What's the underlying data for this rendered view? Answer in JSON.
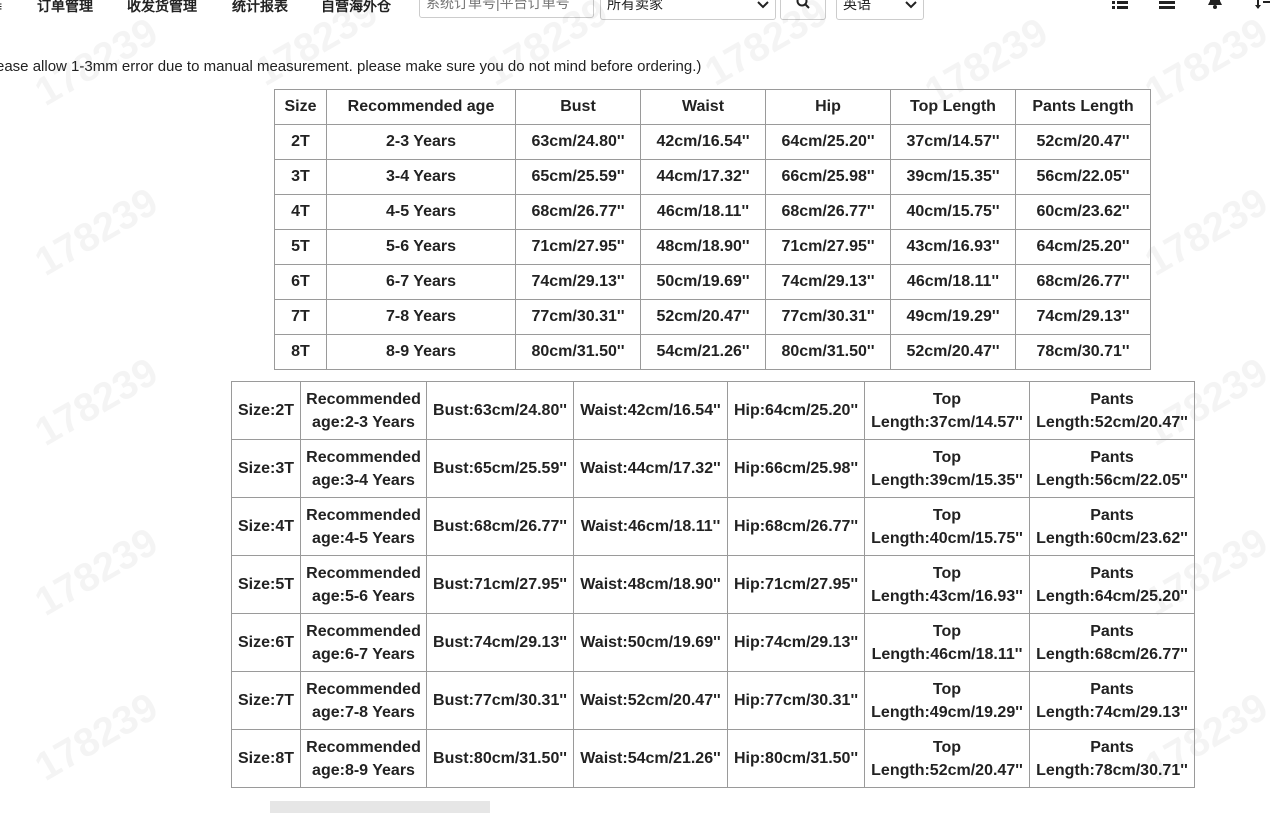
{
  "topbar": {
    "nav": [
      "订单管理",
      "收发货管理",
      "统计报表",
      "自营海外仓"
    ],
    "search_placeholder": "系统订单号|平台订单号",
    "buyer_select": "所有卖家",
    "language_select": "英语",
    "icons": [
      "list-icon",
      "menu-icon",
      "bell-icon",
      "sort-icon",
      "search-icon"
    ]
  },
  "note": "ease allow 1-3mm error due to manual measurement. please make sure you do not mind before ordering.)",
  "watermark": "178239",
  "table1": {
    "headers": [
      "Size",
      "Recommended age",
      "Bust",
      "Waist",
      "Hip",
      "Top Length",
      "Pants Length"
    ],
    "rows": [
      [
        "2T",
        "2-3 Years",
        "63cm/24.80''",
        "42cm/16.54''",
        "64cm/25.20''",
        "37cm/14.57''",
        "52cm/20.47''"
      ],
      [
        "3T",
        "3-4 Years",
        "65cm/25.59''",
        "44cm/17.32''",
        "66cm/25.98''",
        "39cm/15.35''",
        "56cm/22.05''"
      ],
      [
        "4T",
        "4-5 Years",
        "68cm/26.77''",
        "46cm/18.11''",
        "68cm/26.77''",
        "40cm/15.75''",
        "60cm/23.62''"
      ],
      [
        "5T",
        "5-6 Years",
        "71cm/27.95''",
        "48cm/18.90''",
        "71cm/27.95''",
        "43cm/16.93''",
        "64cm/25.20''"
      ],
      [
        "6T",
        "6-7 Years",
        "74cm/29.13''",
        "50cm/19.69''",
        "74cm/29.13''",
        "46cm/18.11''",
        "68cm/26.77''"
      ],
      [
        "7T",
        "7-8 Years",
        "77cm/30.31''",
        "52cm/20.47''",
        "77cm/30.31''",
        "49cm/19.29''",
        "74cm/29.13''"
      ],
      [
        "8T",
        "8-9 Years",
        "80cm/31.50''",
        "54cm/21.26''",
        "80cm/31.50''",
        "52cm/20.47''",
        "78cm/30.71''"
      ]
    ]
  },
  "table2": {
    "rows": [
      [
        [
          "Size:2T"
        ],
        [
          "Recommended",
          "age:2-3 Years"
        ],
        [
          "Bust:63cm/24.80''"
        ],
        [
          "Waist:42cm/16.54''"
        ],
        [
          "Hip:64cm/25.20''"
        ],
        [
          "Top",
          "Length:37cm/14.57''"
        ],
        [
          "Pants",
          "Length:52cm/20.47''"
        ]
      ],
      [
        [
          "Size:3T"
        ],
        [
          "Recommended",
          "age:3-4 Years"
        ],
        [
          "Bust:65cm/25.59''"
        ],
        [
          "Waist:44cm/17.32''"
        ],
        [
          "Hip:66cm/25.98''"
        ],
        [
          "Top",
          "Length:39cm/15.35''"
        ],
        [
          "Pants",
          "Length:56cm/22.05''"
        ]
      ],
      [
        [
          "Size:4T"
        ],
        [
          "Recommended",
          "age:4-5 Years"
        ],
        [
          "Bust:68cm/26.77''"
        ],
        [
          "Waist:46cm/18.11''"
        ],
        [
          "Hip:68cm/26.77''"
        ],
        [
          "Top",
          "Length:40cm/15.75''"
        ],
        [
          "Pants",
          "Length:60cm/23.62''"
        ]
      ],
      [
        [
          "Size:5T"
        ],
        [
          "Recommended",
          "age:5-6 Years"
        ],
        [
          "Bust:71cm/27.95''"
        ],
        [
          "Waist:48cm/18.90''"
        ],
        [
          "Hip:71cm/27.95''"
        ],
        [
          "Top",
          "Length:43cm/16.93''"
        ],
        [
          "Pants",
          "Length:64cm/25.20''"
        ]
      ],
      [
        [
          "Size:6T"
        ],
        [
          "Recommended",
          "age:6-7 Years"
        ],
        [
          "Bust:74cm/29.13''"
        ],
        [
          "Waist:50cm/19.69''"
        ],
        [
          "Hip:74cm/29.13''"
        ],
        [
          "Top",
          "Length:46cm/18.11''"
        ],
        [
          "Pants",
          "Length:68cm/26.77''"
        ]
      ],
      [
        [
          "Size:7T"
        ],
        [
          "Recommended",
          "age:7-8 Years"
        ],
        [
          "Bust:77cm/30.31''"
        ],
        [
          "Waist:52cm/20.47''"
        ],
        [
          "Hip:77cm/30.31''"
        ],
        [
          "Top",
          "Length:49cm/19.29''"
        ],
        [
          "Pants",
          "Length:74cm/29.13''"
        ]
      ],
      [
        [
          "Size:8T"
        ],
        [
          "Recommended",
          "age:8-9 Years"
        ],
        [
          "Bust:80cm/31.50''"
        ],
        [
          "Waist:54cm/21.26''"
        ],
        [
          "Hip:80cm/31.50''"
        ],
        [
          "Top",
          "Length:52cm/20.47''"
        ],
        [
          "Pants",
          "Length:78cm/30.71''"
        ]
      ]
    ]
  }
}
